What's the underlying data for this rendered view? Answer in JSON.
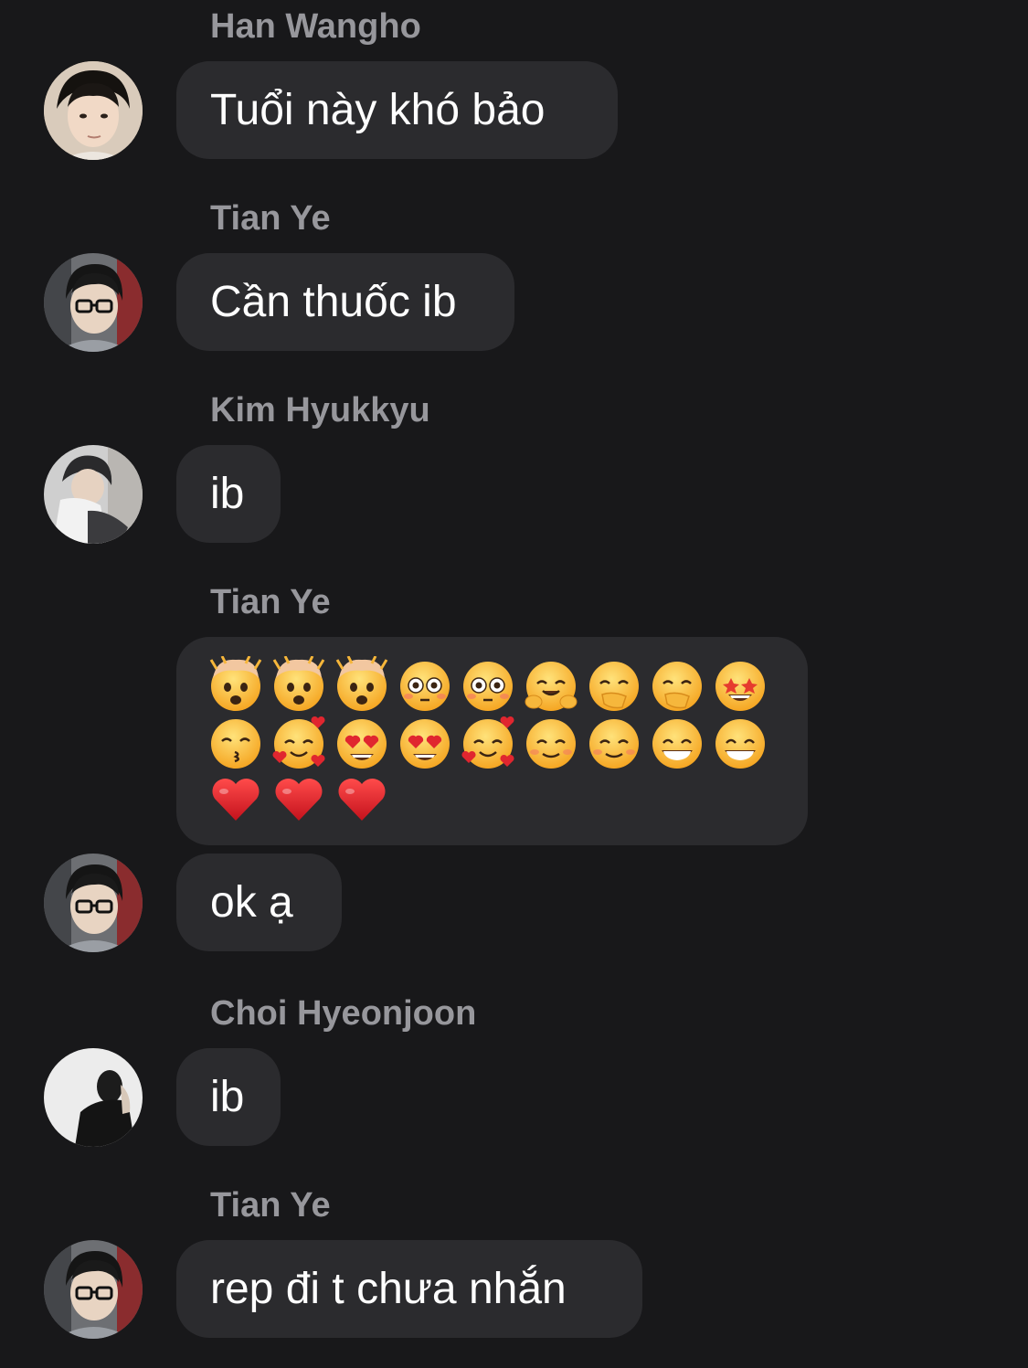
{
  "messages": [
    {
      "sender": "Han Wangho",
      "text": "Tuổi này khó bảo",
      "avatar": "avatar-han-wangho"
    },
    {
      "sender": "Tian Ye",
      "text": "Cần thuốc ib",
      "avatar": "avatar-tian-ye"
    },
    {
      "sender": "Kim Hyukkyu",
      "text": "ib",
      "avatar": "avatar-kim-hyukkyu"
    },
    {
      "sender": "Tian Ye",
      "text": "ok ạ",
      "avatar": "avatar-tian-ye"
    },
    {
      "sender": "Choi Hyeonjoon",
      "text": "ib",
      "avatar": "avatar-choi-hyeonjoon"
    },
    {
      "sender": "Tian Ye",
      "text": "rep đi t chưa nhắn",
      "avatar": "avatar-tian-ye"
    }
  ],
  "emoji_message": {
    "sender": "Tian Ye",
    "rows": [
      [
        "exploding-head",
        "exploding-head",
        "exploding-head",
        "flushed-face",
        "flushed-face",
        "hugging-face",
        "face-with-hand-over-mouth",
        "face-with-hand-over-mouth",
        "star-struck"
      ],
      [
        "kissing-face-smiling-eyes",
        "smiling-face-with-hearts",
        "heart-eyes",
        "heart-eyes",
        "smiling-face-with-hearts",
        "smiling-face",
        "smiling-face",
        "grinning-face",
        "grinning-face"
      ],
      [
        "red-heart",
        "red-heart",
        "red-heart"
      ]
    ]
  },
  "colors": {
    "background": "#18181a",
    "bubble": "#2b2b2e",
    "sender_name": "#97979c",
    "message_text": "#ffffff"
  }
}
